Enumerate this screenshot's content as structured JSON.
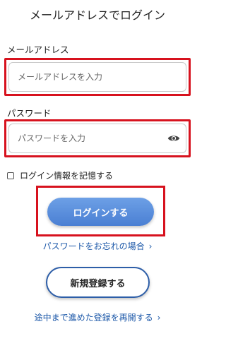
{
  "header": {
    "title": "メールアドレスでログイン"
  },
  "email": {
    "label": "メールアドレス",
    "placeholder": "メールアドレスを入力",
    "value": ""
  },
  "password": {
    "label": "パスワード",
    "placeholder": "パスワードを入力",
    "value": "",
    "toggle_icon": "eye-icon"
  },
  "remember": {
    "label": "ログイン情報を記憶する",
    "checked": false
  },
  "login_button": {
    "label": "ログインする"
  },
  "forgot_link": {
    "label": "パスワードをお忘れの場合",
    "icon": "chevron-right-icon"
  },
  "register_button": {
    "label": "新規登録する"
  },
  "resume_link": {
    "label": "途中まで進めた登録を再開する",
    "icon": "chevron-right-icon"
  },
  "colors": {
    "accent": "#4a7fd3",
    "highlight": "#d7121e",
    "link": "#1b57a8"
  }
}
